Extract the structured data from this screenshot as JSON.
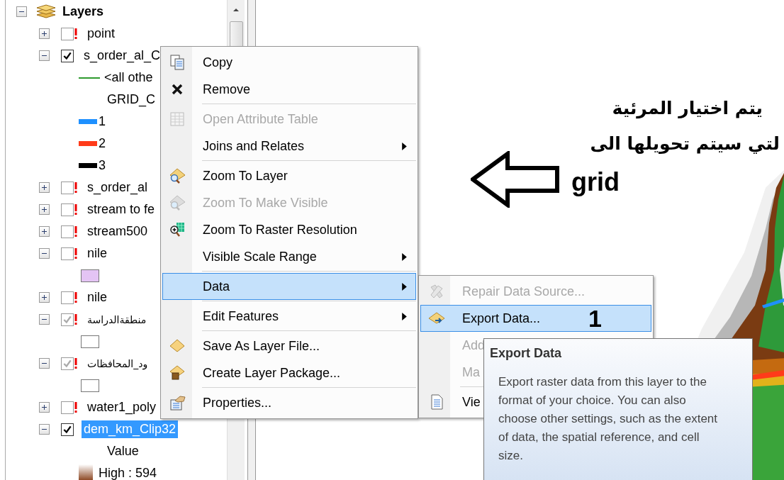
{
  "toc": {
    "title": "Layers",
    "expanded": true,
    "children": [
      {
        "name": "point",
        "expanded": false,
        "checked": false,
        "broken": true,
        "selected": false
      },
      {
        "name": "s_order_al_C",
        "expanded": true,
        "checked": true,
        "broken": false,
        "selected": false,
        "children": [
          {
            "kind": "line",
            "label": "<all othe",
            "color": "#2e9a2e"
          },
          {
            "kind": "label",
            "label": "GRID_C"
          },
          {
            "kind": "bar",
            "label": "1",
            "color": "#1e90ff"
          },
          {
            "kind": "bar",
            "label": "2",
            "color": "#ff3b1a"
          },
          {
            "kind": "bar",
            "label": "3",
            "color": "#000000"
          }
        ]
      },
      {
        "name": "s_order_al",
        "expanded": false,
        "checked": false,
        "broken": true,
        "selected": false
      },
      {
        "name": "stream to fe",
        "expanded": false,
        "checked": false,
        "broken": true,
        "selected": false
      },
      {
        "name": "stream500",
        "expanded": false,
        "checked": false,
        "broken": true,
        "selected": false
      },
      {
        "name": "nile",
        "expanded": true,
        "checked": false,
        "broken": true,
        "selected": false,
        "children": [
          {
            "kind": "fill",
            "color": "#e4c4f4"
          }
        ]
      },
      {
        "name": "nile",
        "expanded": false,
        "checked": false,
        "broken": true,
        "selected": false
      },
      {
        "name": "منطقةالدراسة",
        "expanded": true,
        "checked": true,
        "broken": true,
        "selected": false,
        "children": [
          {
            "kind": "fill",
            "color": "#ffffff"
          }
        ]
      },
      {
        "name": "ود_المحافظات",
        "expanded": true,
        "checked": true,
        "broken": true,
        "selected": false,
        "children": [
          {
            "kind": "fill",
            "color": "#ffffff"
          }
        ]
      },
      {
        "name": "water1_poly",
        "expanded": false,
        "checked": false,
        "broken": true,
        "selected": false
      },
      {
        "name": "dem_km_Clip32",
        "expanded": true,
        "checked": true,
        "broken": false,
        "selected": true,
        "children": [
          {
            "kind": "heading",
            "label": "Value"
          },
          {
            "kind": "ramp",
            "label": "High : 594"
          }
        ]
      }
    ]
  },
  "context_menu": {
    "groups": [
      [
        {
          "label": "Copy",
          "disabled": false,
          "submenu": false,
          "selected": false
        },
        {
          "label": "Remove",
          "disabled": false,
          "submenu": false,
          "selected": false
        }
      ],
      [
        {
          "label": "Open Attribute Table",
          "disabled": true,
          "submenu": false,
          "selected": false
        },
        {
          "label": "Joins and Relates",
          "disabled": false,
          "submenu": true,
          "selected": false
        }
      ],
      [
        {
          "label": "Zoom To Layer",
          "disabled": false,
          "submenu": false,
          "selected": false
        },
        {
          "label": "Zoom To Make Visible",
          "disabled": true,
          "submenu": false,
          "selected": false
        },
        {
          "label": "Zoom To Raster Resolution",
          "disabled": false,
          "submenu": false,
          "selected": false
        },
        {
          "label": "Visible Scale Range",
          "disabled": false,
          "submenu": true,
          "selected": false
        }
      ],
      [
        {
          "label": "Data",
          "disabled": false,
          "submenu": true,
          "selected": true
        }
      ],
      [
        {
          "label": "Edit Features",
          "disabled": false,
          "submenu": true,
          "selected": false
        }
      ],
      [
        {
          "label": "Save As Layer File...",
          "disabled": false,
          "submenu": false,
          "selected": false
        },
        {
          "label": "Create Layer Package...",
          "disabled": false,
          "submenu": false,
          "selected": false
        }
      ],
      [
        {
          "label": "Properties...",
          "disabled": false,
          "submenu": false,
          "selected": false
        }
      ]
    ]
  },
  "data_submenu": {
    "groups": [
      [
        {
          "label": "Repair Data Source...",
          "disabled": true,
          "selected": false
        },
        {
          "label": "Export Data...",
          "disabled": false,
          "selected": true
        },
        {
          "label": "Add",
          "disabled": true,
          "selected": false
        },
        {
          "label": "Ma",
          "disabled": true,
          "selected": false
        }
      ],
      [
        {
          "label": "Vie",
          "disabled": false,
          "selected": false
        }
      ]
    ]
  },
  "tooltip": {
    "title": "Export Data",
    "body": "Export raster data from this layer to the format of your choice. You can also choose other settings, such as the extent of data, the spatial reference, and cell size."
  },
  "annotations": {
    "step": "1",
    "lines": [
      "يتم اختيار  المرئية",
      "لتي سيتم تحويلها الى"
    ],
    "grid": "grid"
  }
}
